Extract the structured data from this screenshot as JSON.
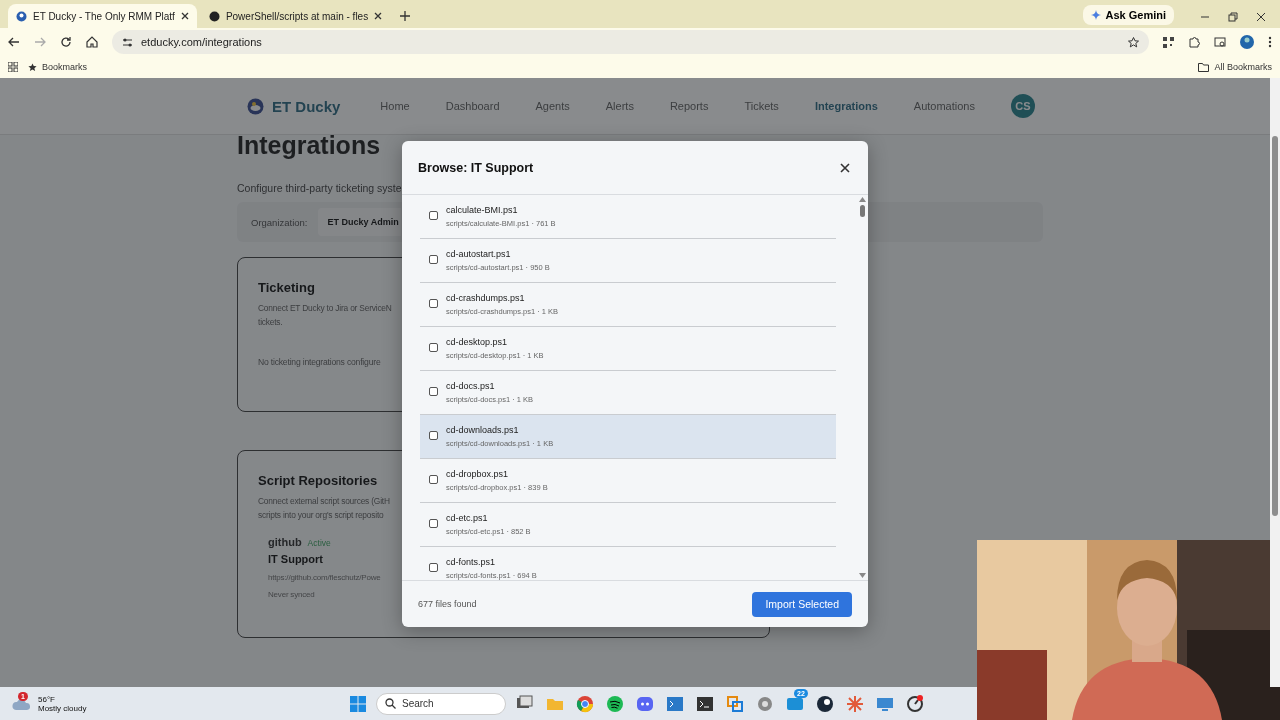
{
  "browser": {
    "tabs": [
      {
        "title": "ET Ducky - The Only RMM Platf",
        "selected": true
      },
      {
        "title": "PowerShell/scripts at main - fles",
        "selected": false
      }
    ],
    "gemini": "Ask Gemini",
    "address": "etducky.com/integrations",
    "bookmarks": "Bookmarks",
    "all_bookmarks": "All Bookmarks"
  },
  "app": {
    "brand": "ET Ducky",
    "nav": [
      {
        "label": "Home",
        "selected": false
      },
      {
        "label": "Dashboard",
        "selected": false
      },
      {
        "label": "Agents",
        "selected": false
      },
      {
        "label": "Alerts",
        "selected": false
      },
      {
        "label": "Reports",
        "selected": false
      },
      {
        "label": "Tickets",
        "selected": false
      },
      {
        "label": "Integrations",
        "selected": true
      },
      {
        "label": "Automations",
        "selected": false
      }
    ],
    "avatar": "CS",
    "title": "Integrations",
    "description": "Configure third-party ticketing syste",
    "organization": {
      "label": "Organization:",
      "value": "ET Ducky Admin"
    },
    "ticketing": {
      "title": "Ticketing",
      "description": [
        "Connect ET Ducky to Jira or ServiceN",
        "tickets."
      ],
      "empty": "No ticketing integrations configure"
    },
    "repositories": {
      "title": "Script Repositories",
      "description": [
        "Connect external script sources (GitH",
        "scripts into your org's script reposito"
      ],
      "repo": {
        "provider": "github",
        "status": "Active",
        "name": "IT Support",
        "url": "https://github.com/fleschutz/Powe",
        "sync": "Never synced"
      }
    }
  },
  "modal": {
    "title": "Browse: IT Support",
    "files": [
      {
        "name": "calculate-BMI.ps1",
        "detail": "scripts/calculate-BMI.ps1 · 761 B",
        "checked": false,
        "hovered": false
      },
      {
        "name": "cd-autostart.ps1",
        "detail": "scripts/cd-autostart.ps1 · 950 B",
        "checked": false,
        "hovered": false
      },
      {
        "name": "cd-crashdumps.ps1",
        "detail": "scripts/cd-crashdumps.ps1 · 1 KB",
        "checked": false,
        "hovered": false
      },
      {
        "name": "cd-desktop.ps1",
        "detail": "scripts/cd-desktop.ps1 · 1 KB",
        "checked": false,
        "hovered": false
      },
      {
        "name": "cd-docs.ps1",
        "detail": "scripts/cd-docs.ps1 · 1 KB",
        "checked": false,
        "hovered": false
      },
      {
        "name": "cd-downloads.ps1",
        "detail": "scripts/cd-downloads.ps1 · 1 KB",
        "checked": false,
        "hovered": true
      },
      {
        "name": "cd-dropbox.ps1",
        "detail": "scripts/cd-dropbox.ps1 · 839 B",
        "checked": false,
        "hovered": false
      },
      {
        "name": "cd-etc.ps1",
        "detail": "scripts/cd-etc.ps1 · 852 B",
        "checked": false,
        "hovered": false
      },
      {
        "name": "cd-fonts.ps1",
        "detail": "scripts/cd-fonts.ps1 · 694 B",
        "checked": false,
        "hovered": false
      }
    ],
    "count": "677 files found",
    "button": "Import Selected"
  },
  "taskbar": {
    "weather_badge": "1",
    "temperature": "56°F",
    "condition": "Mostly cloudy",
    "search": "Search",
    "app_badge": "22"
  }
}
